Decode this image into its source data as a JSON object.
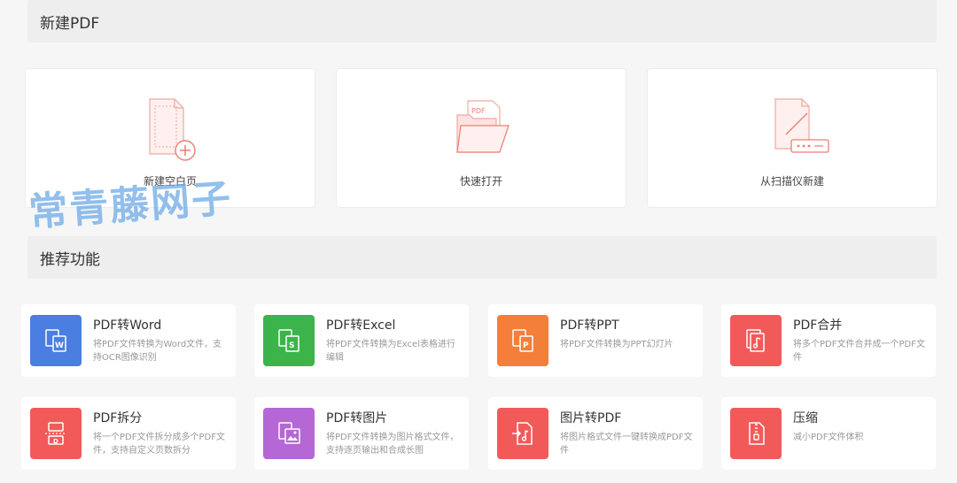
{
  "new_pdf": {
    "title": "新建PDF",
    "cards": [
      {
        "label": "新建空白页",
        "icon": "blank-page-add-icon"
      },
      {
        "label": "快速打开",
        "icon": "folder-pdf-icon"
      },
      {
        "label": "从扫描仪新建",
        "icon": "scanner-icon"
      }
    ]
  },
  "recommended": {
    "title": "推荐功能",
    "features": [
      {
        "title": "PDF转Word",
        "desc": "将PDF文件转换为Word文件，支持OCR图像识别",
        "color": "#4a7ee0",
        "icon": "pdf-to-word-icon"
      },
      {
        "title": "PDF转Excel",
        "desc": "将PDF文件转换为Excel表格进行编辑",
        "color": "#3cb44b",
        "icon": "pdf-to-excel-icon"
      },
      {
        "title": "PDF转PPT",
        "desc": "将PDF文件转换为PPT幻灯片",
        "color": "#f37f3a",
        "icon": "pdf-to-ppt-icon"
      },
      {
        "title": "PDF合并",
        "desc": "将多个PDF文件合并成一个PDF文件",
        "color": "#f25a5a",
        "icon": "pdf-merge-icon"
      },
      {
        "title": "PDF拆分",
        "desc": "将一个PDF文件拆分成多个PDF文件，支持自定义页数拆分",
        "color": "#f25a5a",
        "icon": "pdf-split-icon"
      },
      {
        "title": "PDF转图片",
        "desc": "将PDF文件转换为图片格式文件，支持逐页输出和合成长图",
        "color": "#b567d6",
        "icon": "pdf-to-image-icon"
      },
      {
        "title": "图片转PDF",
        "desc": "将图片格式文件一键转换成PDF文件",
        "color": "#f25a5a",
        "icon": "image-to-pdf-icon"
      },
      {
        "title": "压缩",
        "desc": "减小PDF文件体积",
        "color": "#f25a5a",
        "icon": "compress-icon"
      }
    ]
  },
  "watermark": "常青藤网子"
}
